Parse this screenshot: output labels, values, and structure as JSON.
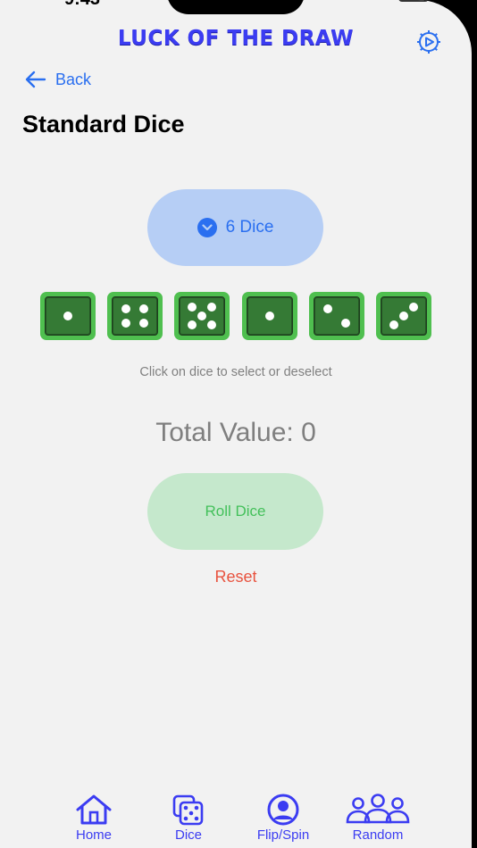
{
  "status_bar": {
    "time": "9:43"
  },
  "header": {
    "title": "LUCK OF THE DRAW",
    "settings_icon": "gear-play-icon"
  },
  "nav": {
    "back_label": "Back"
  },
  "page": {
    "title": "Standard Dice"
  },
  "dice_selector": {
    "label": "6 Dice",
    "icon": "chevron-down-circle-icon"
  },
  "dice": [
    1,
    4,
    5,
    1,
    2,
    3
  ],
  "hint": "Click on dice to select or deselect",
  "total_label": "Total Value: 0",
  "roll_button": "Roll Dice",
  "reset_button": "Reset",
  "tabs": [
    {
      "label": "Home",
      "icon": "house-icon"
    },
    {
      "label": "Dice",
      "icon": "dice-icon"
    },
    {
      "label": "Flip/Spin",
      "icon": "person-circle-icon"
    },
    {
      "label": "Random",
      "icon": "group-icon"
    }
  ],
  "colors": {
    "accent": "#2a6ff0",
    "title": "#3b3cf2",
    "die_border": "#4fbf4f",
    "die_face": "#357a35",
    "roll_bg": "#c5e8cc",
    "roll_text": "#43c05a",
    "reset_text": "#e8533f",
    "select_bg": "#b6cef5"
  }
}
